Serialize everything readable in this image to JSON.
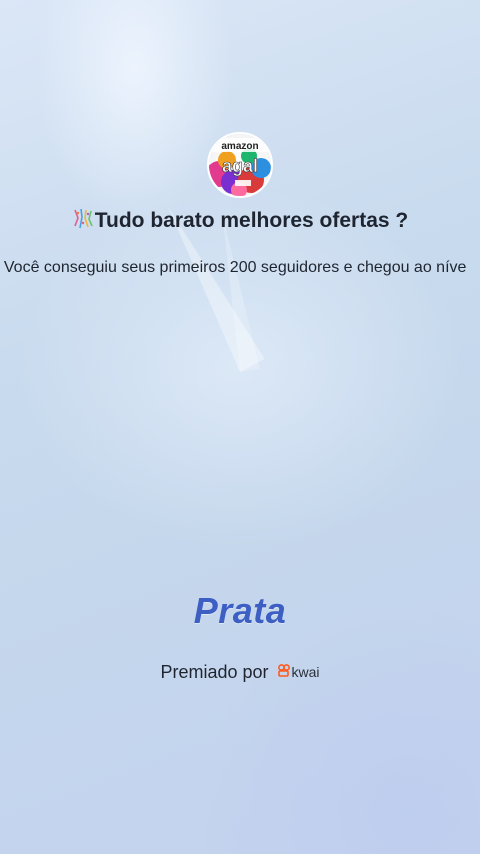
{
  "profile": {
    "avatar_text_top": "amazon",
    "avatar_text_main": "agal",
    "name": "Tudo barato melhores ofertas ?"
  },
  "congrats": {
    "message": "! Você conseguiu seus primeiros 200 seguidores e chegou ao níve"
  },
  "level": {
    "name": "Prata",
    "color": "#3d5fc4"
  },
  "award": {
    "label": "Premiado por",
    "brand": "kwai",
    "brand_color": "#ff5a1f"
  },
  "icons": {
    "confetti": "confetti-icon",
    "brand_logo": "kwai-logo-icon"
  }
}
